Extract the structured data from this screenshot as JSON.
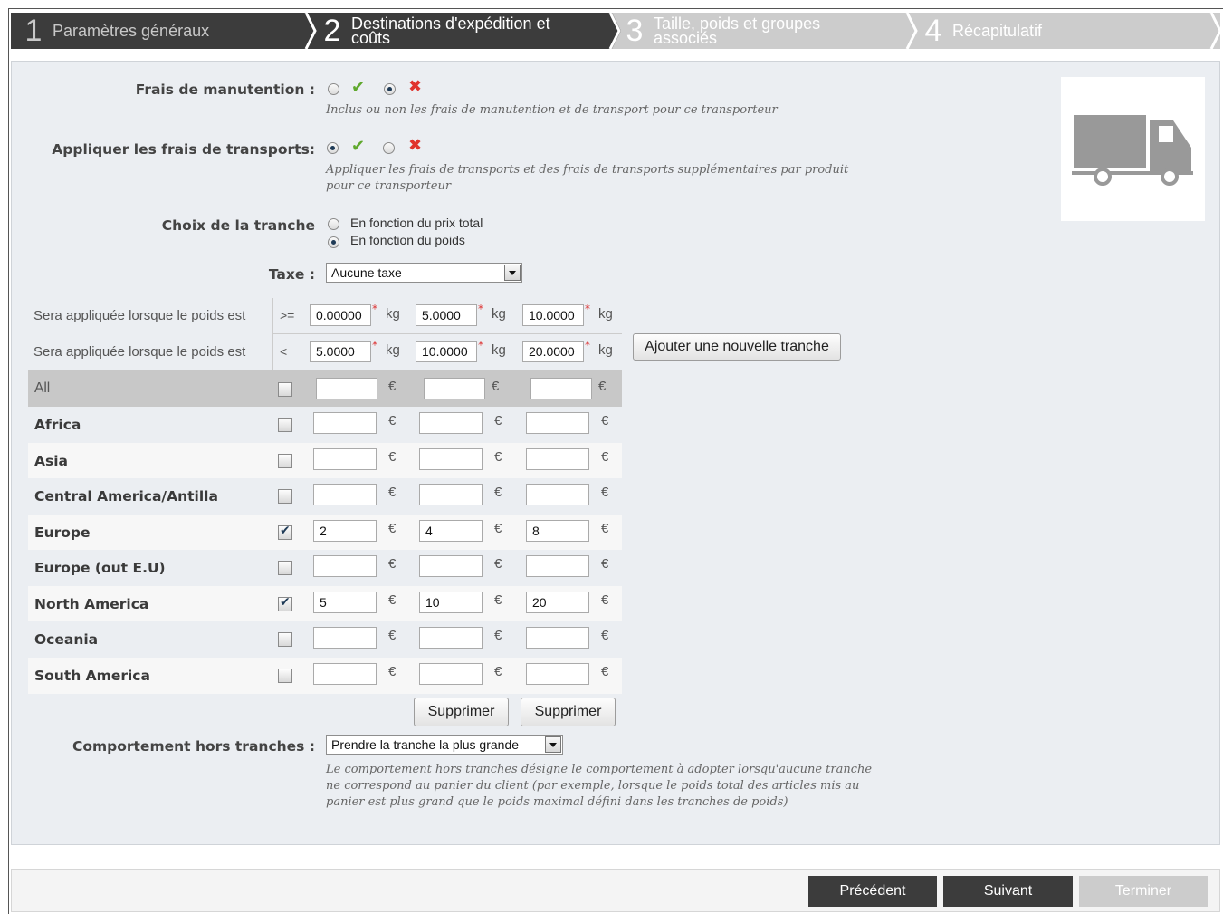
{
  "steps": [
    {
      "num": "1",
      "label": "Paramètres généraux",
      "active": false
    },
    {
      "num": "2",
      "label": "Destinations d'expédition et coûts",
      "active": true
    },
    {
      "num": "3",
      "label": "Taille, poids et groupes associés",
      "active": false
    },
    {
      "num": "4",
      "label": "Récapitulatif",
      "active": false
    }
  ],
  "handling": {
    "label": "Frais de manutention :",
    "selected": "no",
    "help": "Inclus ou non les frais de manutention et de transport pour ce transporteur"
  },
  "shipping_fees": {
    "label": "Appliquer les frais de transports:",
    "selected": "yes",
    "help_line1": "Appliquer les frais de transports et des frais de transports supplémentaires par produit",
    "help_line2": "pour ce transporteur"
  },
  "range_choice": {
    "label": "Choix de la tranche",
    "options": [
      "En fonction du prix total",
      "En fonction du poids"
    ],
    "selected_index": 1
  },
  "tax": {
    "label": "Taxe :",
    "value": "Aucune taxe"
  },
  "ranges": {
    "label": "Sera appliquée lorsque le poids est",
    "op_from": ">=",
    "op_to": "<",
    "unit": "kg",
    "from": [
      "0.00000",
      "5.0000",
      "10.0000"
    ],
    "to": [
      "5.0000",
      "10.0000",
      "20.0000"
    ],
    "add_button": "Ajouter une nouvelle tranche"
  },
  "currency": "€",
  "all_row": {
    "label": "All"
  },
  "zones": [
    {
      "name": "Africa",
      "checked": false,
      "prices": [
        "",
        "",
        ""
      ]
    },
    {
      "name": "Asia",
      "checked": false,
      "prices": [
        "",
        "",
        ""
      ]
    },
    {
      "name": "Central America/Antilla",
      "checked": false,
      "prices": [
        "",
        "",
        ""
      ]
    },
    {
      "name": "Europe",
      "checked": true,
      "prices": [
        "2",
        "4",
        "8"
      ]
    },
    {
      "name": "Europe (out E.U)",
      "checked": false,
      "prices": [
        "",
        "",
        ""
      ]
    },
    {
      "name": "North America",
      "checked": true,
      "prices": [
        "5",
        "10",
        "20"
      ]
    },
    {
      "name": "Oceania",
      "checked": false,
      "prices": [
        "",
        "",
        ""
      ]
    },
    {
      "name": "South America",
      "checked": false,
      "prices": [
        "",
        "",
        ""
      ]
    }
  ],
  "delete_button": "Supprimer",
  "out_of_range": {
    "label": "Comportement hors tranches :",
    "value": "Prendre la tranche la plus grande",
    "help_line1": "Le comportement hors tranches désigne le comportement à adopter lorsqu'aucune tranche",
    "help_line2": "ne correspond au panier du client (par exemple, lorsque le poids total des articles mis au",
    "help_line3": "panier est plus grand que le poids maximal défini dans les tranches de poids)"
  },
  "footer": {
    "prev": "Précédent",
    "next": "Suivant",
    "finish": "Terminer"
  },
  "colors": {
    "step_active": "#3c3c3c",
    "step_inactive": "#cccccc",
    "panel_bg": "#ebeef2",
    "ok_green": "#5fa82d",
    "no_red": "#e0332d",
    "footer_btn": "#3c3c3c",
    "footer_btn_disabled": "#cccccc"
  },
  "icons": {
    "truck": "truck-icon"
  }
}
